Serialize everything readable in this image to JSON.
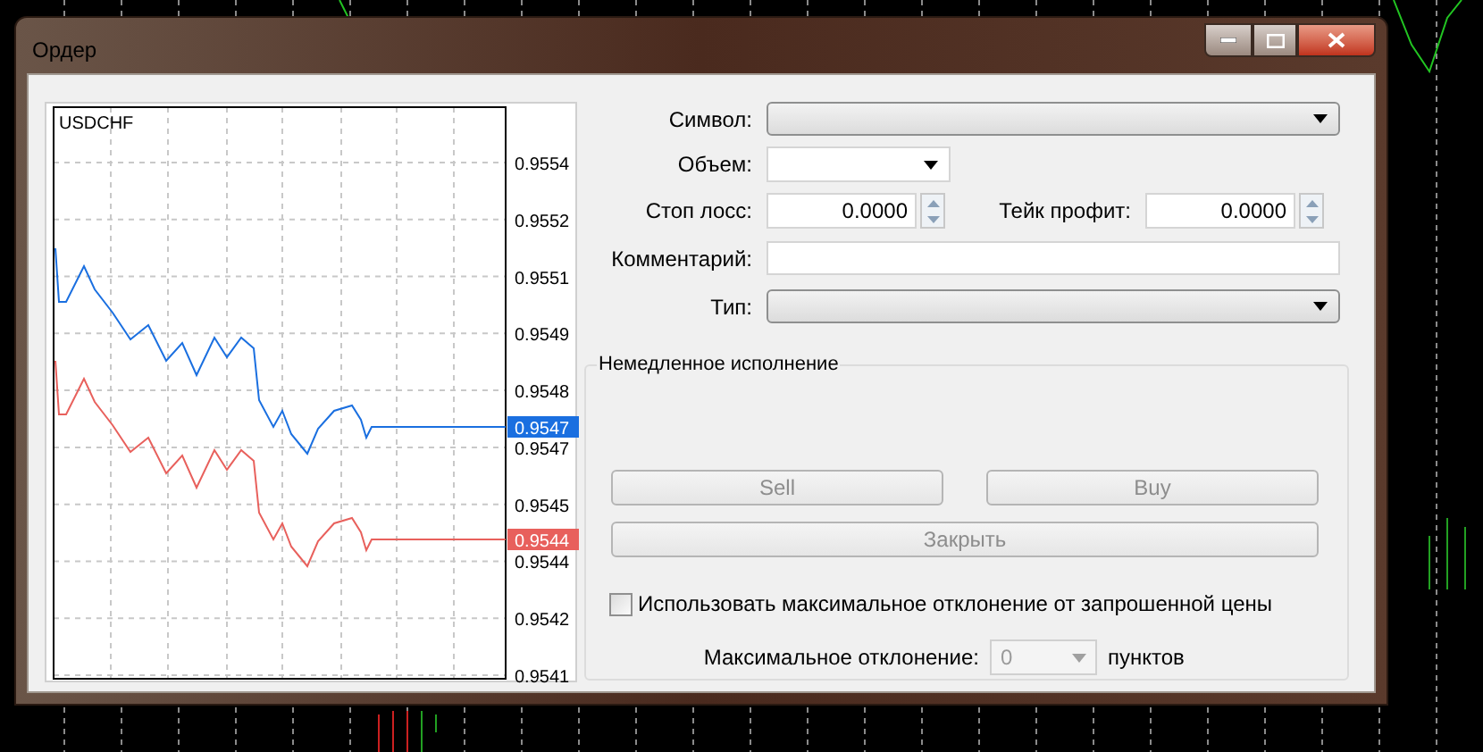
{
  "window": {
    "title": "Ордер"
  },
  "chart": {
    "symbol": "USDCHF",
    "axis_labels": [
      "0.9554",
      "0.9552",
      "0.9551",
      "0.9549",
      "0.9548",
      "0.9547",
      "0.9545",
      "0.9544",
      "0.9542",
      "0.9541"
    ],
    "price_tags": [
      {
        "text": "0.9547",
        "color": "#1a6fe0"
      },
      {
        "text": "0.9544",
        "color": "#e8605c"
      }
    ]
  },
  "form": {
    "symbol": {
      "label": "Символ:"
    },
    "volume": {
      "label": "Объем:"
    },
    "stop_loss": {
      "label": "Стоп лосс:",
      "value": "0.0000"
    },
    "take_profit": {
      "label": "Тейк профит:",
      "value": "0.0000"
    },
    "comment": {
      "label": "Комментарий:"
    },
    "type": {
      "label": "Тип:"
    }
  },
  "execution": {
    "title": "Немедленное исполнение",
    "buttons": [
      {
        "label": "Sell",
        "disabled": true
      },
      {
        "label": "Buy",
        "disabled": true
      },
      {
        "label": "Закрыть",
        "disabled": true
      }
    ],
    "deviation_checkbox": {
      "label": "Использовать максимальное отклонение от запрошенной цены",
      "checked": false
    },
    "max_deviation": {
      "label": "Максимальное отклонение:",
      "value": "0",
      "unit": "пунктов",
      "disabled": true
    }
  }
}
